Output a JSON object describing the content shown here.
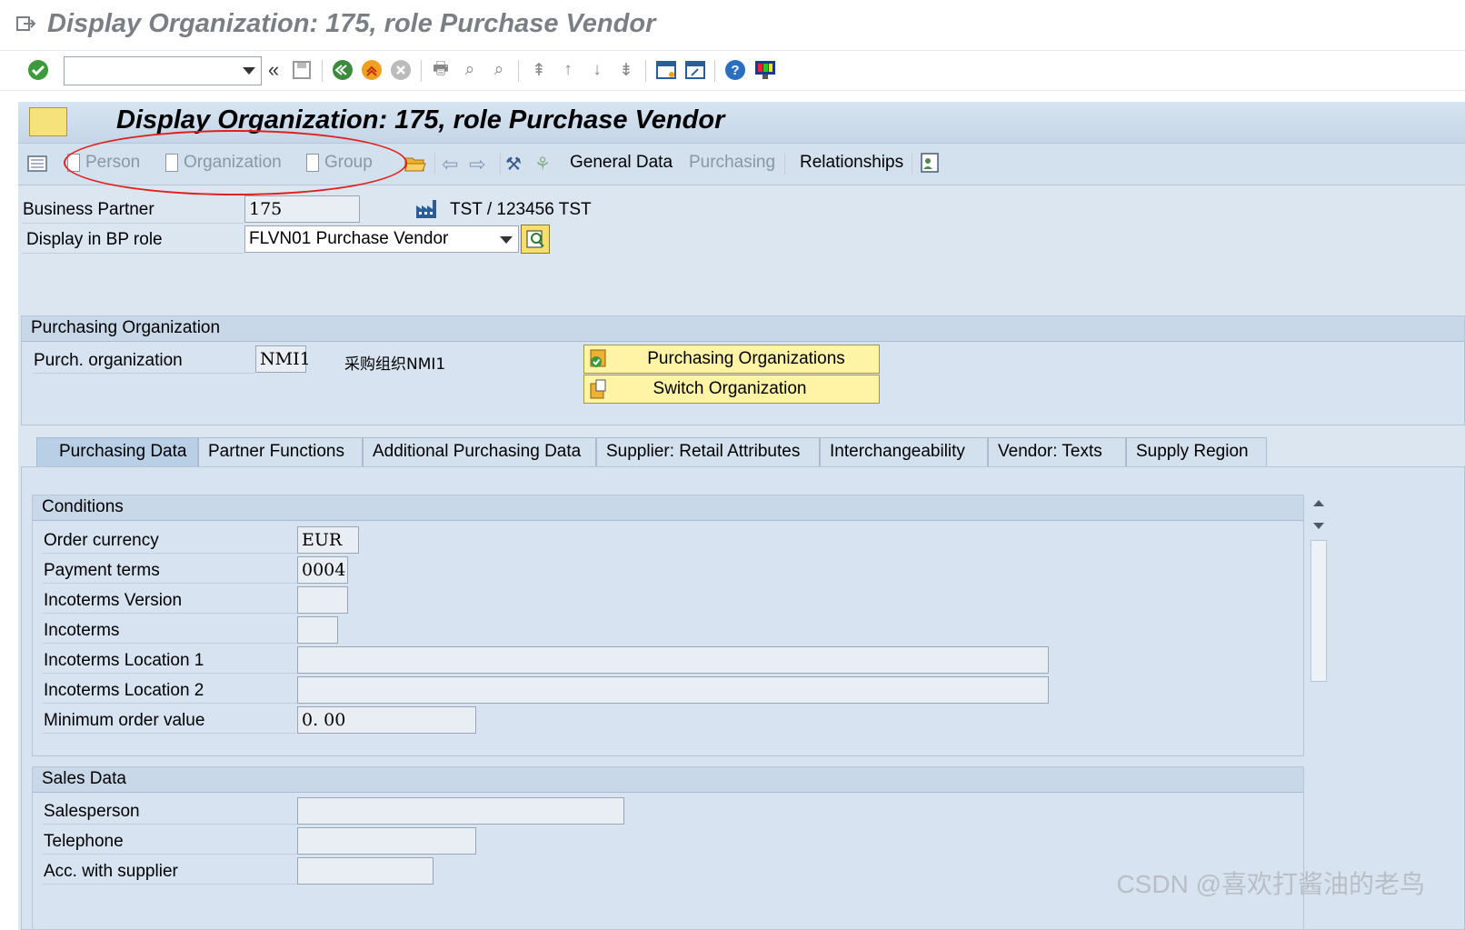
{
  "window_title": "Display Organization: 175, role Purchase Vendor",
  "main_title": "Display Organization: 175, role Purchase Vendor",
  "app_toolbar": {
    "person": "Person",
    "organization": "Organization",
    "group": "Group",
    "general_data": "General Data",
    "purchasing": "Purchasing",
    "relationships": "Relationships"
  },
  "header": {
    "business_partner_label": "Business Partner",
    "business_partner_value": "175",
    "partner_name": "TST / 123456 TST",
    "bp_role_label": "Display in BP role",
    "bp_role_value": "FLVN01 Purchase Vendor"
  },
  "purch_org_section": {
    "title": "Purchasing Organization",
    "label": "Purch. organization",
    "value": "NMI1",
    "description": "采购组织NMI1",
    "btn_purch_orgs": "Purchasing Organizations",
    "btn_switch_org": "Switch Organization"
  },
  "tabs": [
    {
      "label": "Purchasing Data",
      "active": true
    },
    {
      "label": "Partner Functions"
    },
    {
      "label": "Additional Purchasing Data"
    },
    {
      "label": "Supplier: Retail Attributes"
    },
    {
      "label": "Interchangeability"
    },
    {
      "label": "Vendor: Texts"
    },
    {
      "label": "Supply Region"
    }
  ],
  "conditions": {
    "title": "Conditions",
    "order_currency_label": "Order currency",
    "order_currency_value": "EUR",
    "payment_terms_label": "Payment terms",
    "payment_terms_value": "0004",
    "incoterms_version_label": "Incoterms Version",
    "incoterms_label": "Incoterms",
    "incoterms_loc1_label": "Incoterms Location 1",
    "incoterms_loc2_label": "Incoterms Location 2",
    "min_order_label": "Minimum order value",
    "min_order_value": "0. 00"
  },
  "sales_data": {
    "title": "Sales Data",
    "salesperson_label": "Salesperson",
    "telephone_label": "Telephone",
    "acc_supplier_label": "Acc. with supplier"
  },
  "watermark": "CSDN @喜欢打酱油的老鸟",
  "colors": {
    "annotation_red": "#e0201c",
    "button_yellow": "#fff3a6",
    "panel_blue": "#d7e3f0"
  }
}
